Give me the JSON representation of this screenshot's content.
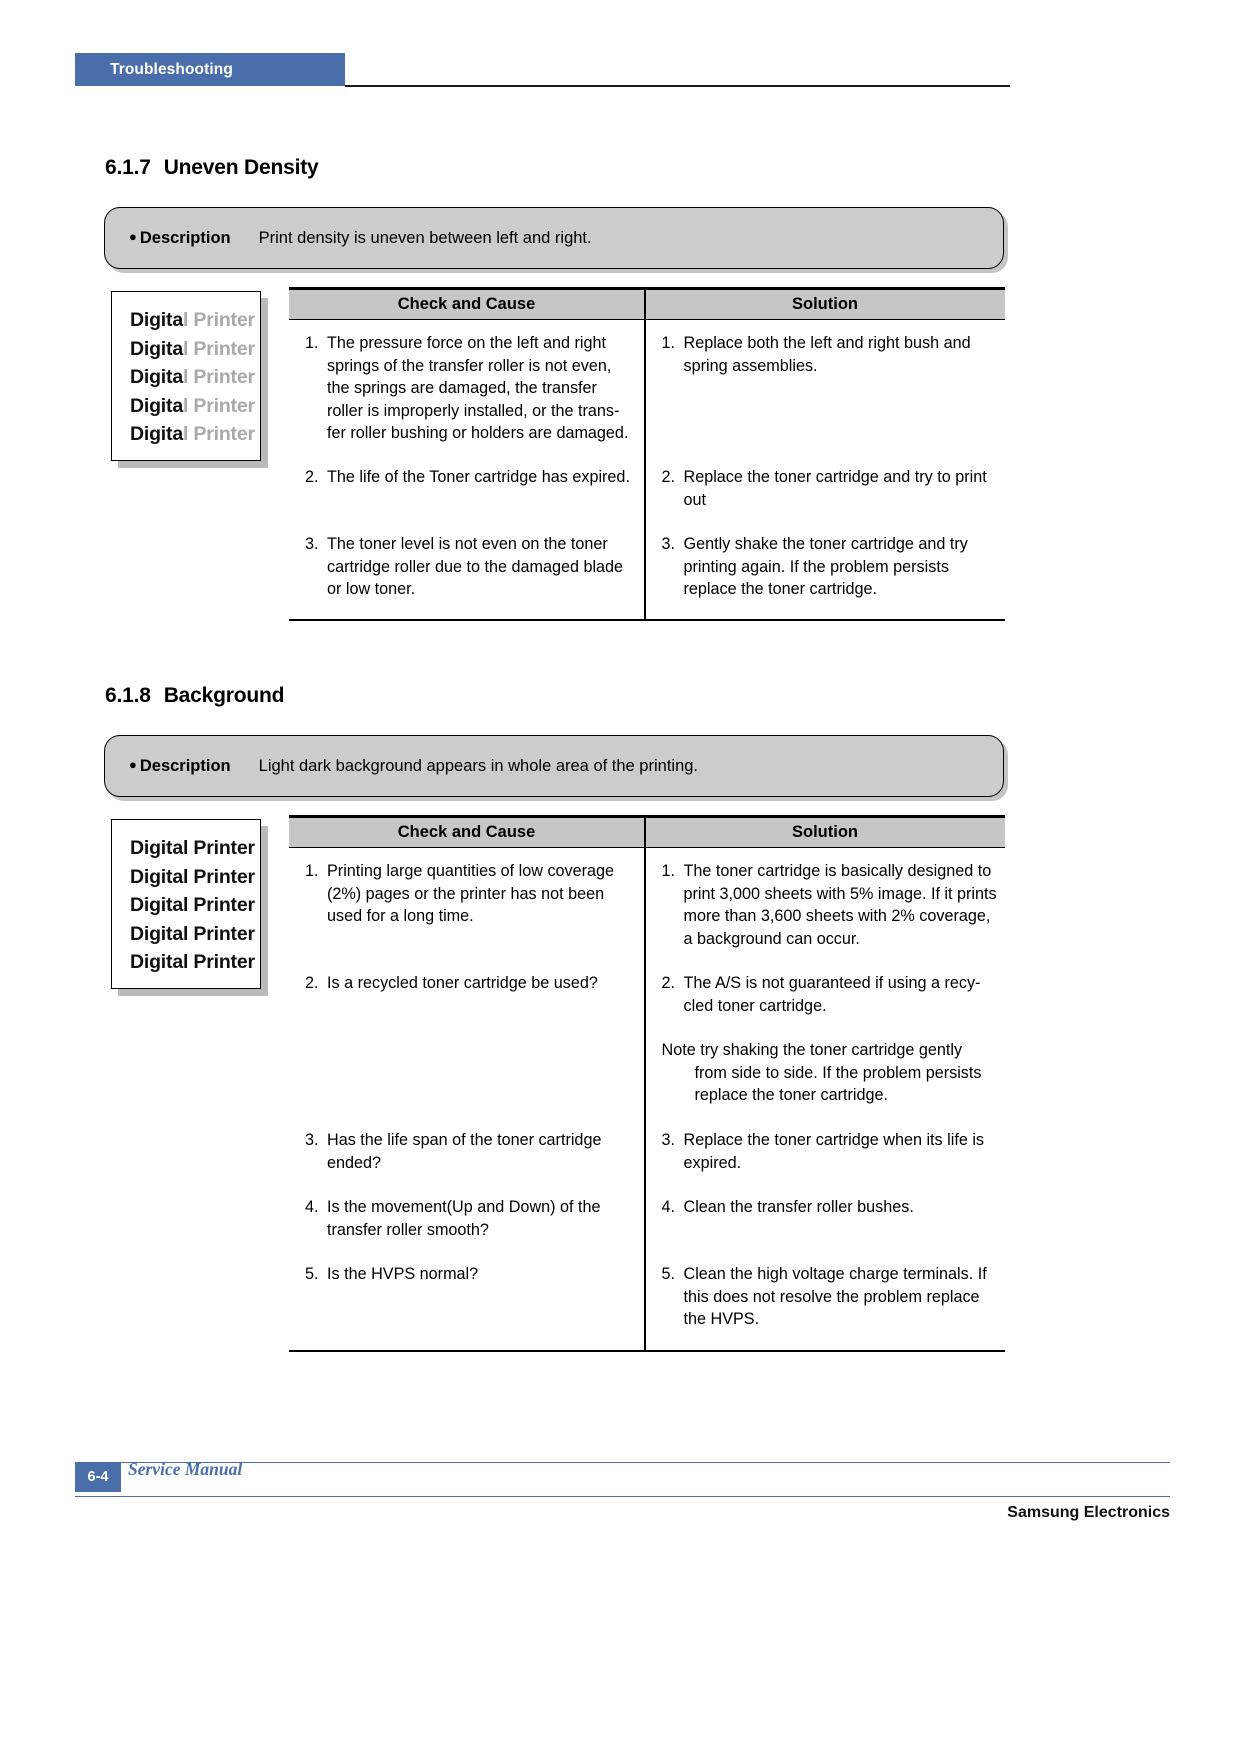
{
  "header": {
    "tab_label": "Troubleshooting"
  },
  "sections": [
    {
      "number": "6.1.7",
      "title": "Uneven Density",
      "description_label": "Description",
      "description_text": "Print density is uneven between left and right.",
      "sample": {
        "lines": [
          {
            "dark": "Digita",
            "faded": "l Printer"
          },
          {
            "dark": "Digita",
            "faded": "l Printer"
          },
          {
            "dark": "Digita",
            "faded": "l Printer"
          },
          {
            "dark": "Digita",
            "faded": "l Printer"
          },
          {
            "dark": "Digita",
            "faded": "l Printer"
          }
        ]
      },
      "table": {
        "headers": [
          "Check and Cause",
          "Solution"
        ],
        "causes": [
          {
            "num": "1.",
            "text": "The pressure force on the left and right springs of the transfer roller is not even, the springs are damaged, the transfer roller is improperly installed, or the trans-fer roller bushing or holders are damaged."
          },
          {
            "num": "2.",
            "text": "The life of the Toner cartridge has expired."
          },
          {
            "num": "3.",
            "text": "The toner level is not even on the toner cartridge roller due to the damaged blade or low toner."
          }
        ],
        "solutions": [
          {
            "num": "1.",
            "text": "Replace both the left and right bush and spring assemblies."
          },
          {
            "num": "2.",
            "text": "Replace the toner cartridge and try to print out"
          },
          {
            "num": "3.",
            "text": "Gently shake the toner cartridge and try printing again. If the problem persists replace the toner cartridge."
          }
        ]
      }
    },
    {
      "number": "6.1.8",
      "title": "Background",
      "description_label": "Description",
      "description_text": "Light dark background appears in whole area of the printing.",
      "sample": {
        "lines": [
          {
            "dark": "Digital Printer",
            "faded": ""
          },
          {
            "dark": "Digital Printer",
            "faded": ""
          },
          {
            "dark": "Digital Printer",
            "faded": ""
          },
          {
            "dark": "Digital Printer",
            "faded": ""
          },
          {
            "dark": "Digital Printer",
            "faded": ""
          }
        ]
      },
      "table": {
        "headers": [
          "Check and Cause",
          "Solution"
        ],
        "causes": [
          {
            "num": "1.",
            "text": "Printing large quantities of low coverage (2%) pages or the printer has not been used for a long time."
          },
          {
            "num": "2.",
            "text": "Is a recycled toner cartridge be used?"
          },
          {
            "num": "3.",
            "text": "Has the life span of the toner cartridge ended?"
          },
          {
            "num": "4.",
            "text": "Is the movement(Up and Down) of the transfer roller smooth?"
          },
          {
            "num": "5.",
            "text": "Is the HVPS normal?"
          }
        ],
        "solutions": [
          {
            "num": "1.",
            "text": "The toner cartridge is basically designed to print 3,000 sheets with 5% image. If it prints more than 3,600 sheets with 2% coverage, a background can occur."
          },
          {
            "num": "2.",
            "text": "The A/S is not guaranteed if using a recy-cled toner cartridge."
          },
          {
            "num": "3.",
            "text": "Replace the toner cartridge when its life is expired."
          },
          {
            "num": "4.",
            "text": "Clean the transfer roller bushes."
          },
          {
            "num": "5.",
            "text": "Clean the high voltage charge terminals. If this does not resolve the problem replace the HVPS."
          }
        ],
        "note": {
          "label": "Note",
          "text": " try shaking the toner cartridge gently",
          "continuation": "from side to side. If the problem persists replace the toner cartridge."
        }
      }
    }
  ],
  "footer": {
    "page_number": "6-4",
    "service_manual": "Service Manual",
    "brand": "Samsung Electronics"
  },
  "colors": {
    "accent_blue": "#4a6ea9",
    "table_header_gray": "#c6c6c6",
    "desc_box_gray": "#cccccc",
    "faded_text_gray": "#a9a9a9"
  }
}
